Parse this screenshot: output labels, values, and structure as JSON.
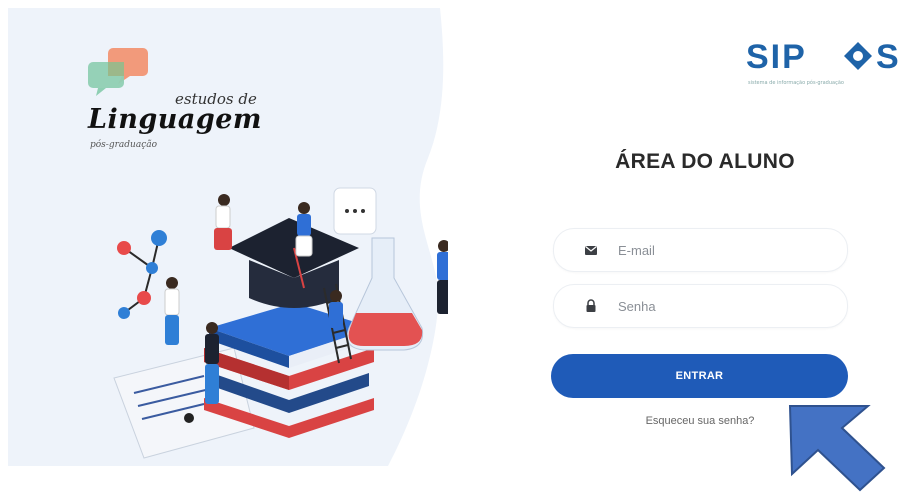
{
  "logo": {
    "line1": "estudos de",
    "line2": "Linguagem",
    "line3": "pós-graduação"
  },
  "brand": {
    "name": "SIPOS",
    "tagline": "sistema de informação pós-graduação"
  },
  "login": {
    "title": "ÁREA DO ALUNO",
    "email_placeholder": "E-mail",
    "password_placeholder": "Senha",
    "submit_label": "ENTRAR",
    "forgot_label": "Esqueceu sua senha?"
  },
  "colors": {
    "primary": "#1f5bb8",
    "arrow": "#4472c4",
    "brand_blue": "#1e63a8",
    "blob": "#eef3fa"
  },
  "icons": [
    "envelope-icon",
    "lock-icon",
    "pointer-arrow-icon"
  ]
}
